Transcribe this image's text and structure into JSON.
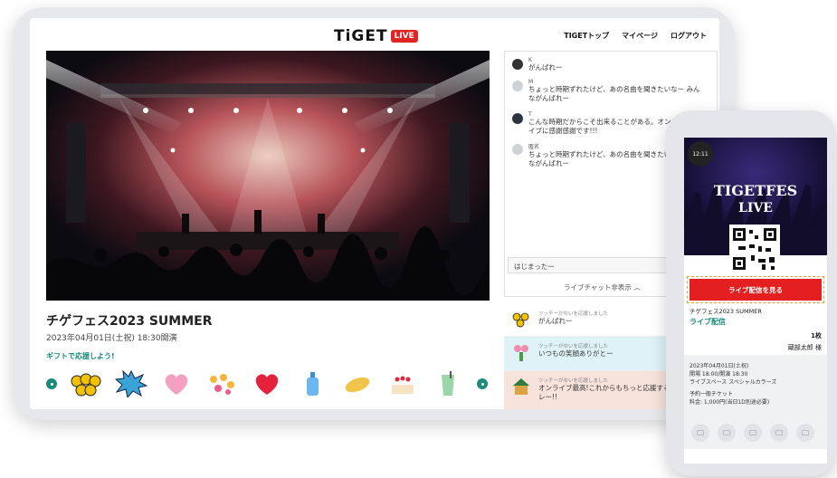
{
  "header": {
    "logo_text": "TiGET",
    "logo_badge": "LIVE",
    "nav": [
      "TIGETトップ",
      "マイページ",
      "ログアウト"
    ]
  },
  "event": {
    "title": "チゲフェス2023 SUMMER",
    "date": "2023年04月01日(土祝) 18:30開演",
    "gift_label": "ギフトで応援しよう!"
  },
  "chat": {
    "messages": [
      {
        "name": "K",
        "text": "がんばれー"
      },
      {
        "name": "M",
        "text": "ちょっと時期ずれたけど、あの名曲を聞きたいなー みんながんばれー"
      },
      {
        "name": "T",
        "text": "こんな時期だからこそ出来ることがある。オンラインライブに感謝感謝です!!!"
      },
      {
        "name": "匿名",
        "text": "ちょっと時期ずれたけど、あの名曲を聞きたいなー みんながんばれー"
      }
    ],
    "input_value": "はじまったー",
    "toggle_label": "ライブチャット非表示 ︿"
  },
  "gift_log": [
    {
      "name": "ツッチーがゆいを応援しました",
      "text": "がんばれー",
      "bg": "#ffffff"
    },
    {
      "name": "ツッチーがゆいを応援しました",
      "text": "いつもの笑顔ありがとー",
      "bg": "#dff2f8"
    },
    {
      "name": "ツッチーがゆいを応援しました",
      "text": "オンライブ最高!これからもちっと応援するからガンバレー!!",
      "bg": "#f8e2dc"
    }
  ],
  "phone": {
    "time": "12:11",
    "poster_title_1": "TIGETFES",
    "poster_title_2": "LIVE",
    "watch_button": "ライブ配信を見る",
    "event_title": "チゲフェス2023 SUMMER",
    "live_label": "ライブ配信",
    "count": "1枚",
    "holder": "蔵部太郎 様",
    "info": [
      "2023年04月01日(土祝)",
      "開場 18:00/開演 18:30",
      "ライブスペース スペシャルカラーズ",
      "",
      "予約一般チケット",
      "料金: 1,000円(当日1D別途必要)"
    ]
  },
  "colors": {
    "accent_green": "#1a8a7c",
    "live_red": "#e02424",
    "button_red": "#e31f1f"
  }
}
